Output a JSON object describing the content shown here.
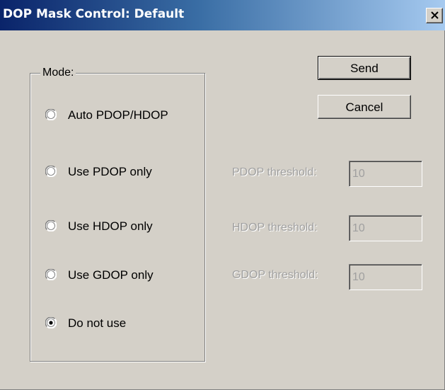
{
  "window": {
    "title": "DOP Mask Control: Default"
  },
  "mode_group": {
    "legend": "Mode:",
    "options": [
      {
        "label": "Auto PDOP/HDOP",
        "selected": false
      },
      {
        "label": "Use PDOP only",
        "selected": false
      },
      {
        "label": "Use HDOP only",
        "selected": false
      },
      {
        "label": "Use GDOP only",
        "selected": false
      },
      {
        "label": "Do not use",
        "selected": true
      }
    ]
  },
  "buttons": {
    "send_label": "Send",
    "cancel_label": "Cancel"
  },
  "thresholds": {
    "pdop": {
      "label": "PDOP threshold:",
      "value": "10",
      "enabled": false
    },
    "hdop": {
      "label": "HDOP threshold:",
      "value": "10",
      "enabled": false
    },
    "gdop": {
      "label": "GDOP threshold:",
      "value": "10",
      "enabled": false
    }
  },
  "icons": {
    "close": "close-icon"
  },
  "colors": {
    "title_start": "#0a246a",
    "title_end": "#a6caf0",
    "dialog_face": "#d4d0c8",
    "disabled_text": "#a0a0a0"
  }
}
